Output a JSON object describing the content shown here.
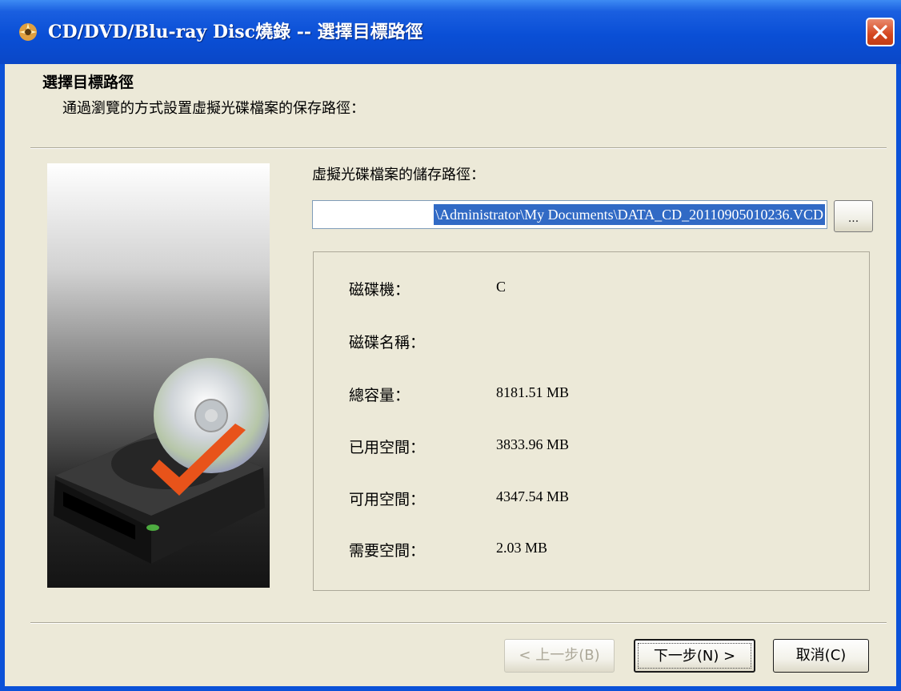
{
  "window": {
    "title": "CD/DVD/Blu-ray Disc燒錄 -- 選擇目標路徑",
    "app_icon": "disc-burner-icon",
    "close_icon": "close-icon"
  },
  "header": {
    "title": "選擇目標路徑",
    "subtitle": "通過瀏覽的方式設置虛擬光碟檔案的保存路徑："
  },
  "path": {
    "label": "虛擬光碟檔案的儲存路徑：",
    "value": "\\Administrator\\My Documents\\DATA_CD_20110905010236.VCD",
    "browse_label": "..."
  },
  "disk_info": [
    {
      "label": "磁碟機：",
      "value": "C"
    },
    {
      "label": "磁碟名稱：",
      "value": ""
    },
    {
      "label": "總容量：",
      "value": "8181.51 MB"
    },
    {
      "label": "已用空間：",
      "value": "3833.96 MB"
    },
    {
      "label": "可用空間：",
      "value": "4347.54 MB"
    },
    {
      "label": "需要空間：",
      "value": "2.03 MB"
    }
  ],
  "buttons": {
    "back": "< 上一步(B)",
    "next": "下一步(N) >",
    "cancel": "取消(C)"
  },
  "colors": {
    "titlebar": "#0a4fd6",
    "dialog_bg": "#ece9d8",
    "selection": "#316ac5",
    "close_button": "#d4461f"
  }
}
